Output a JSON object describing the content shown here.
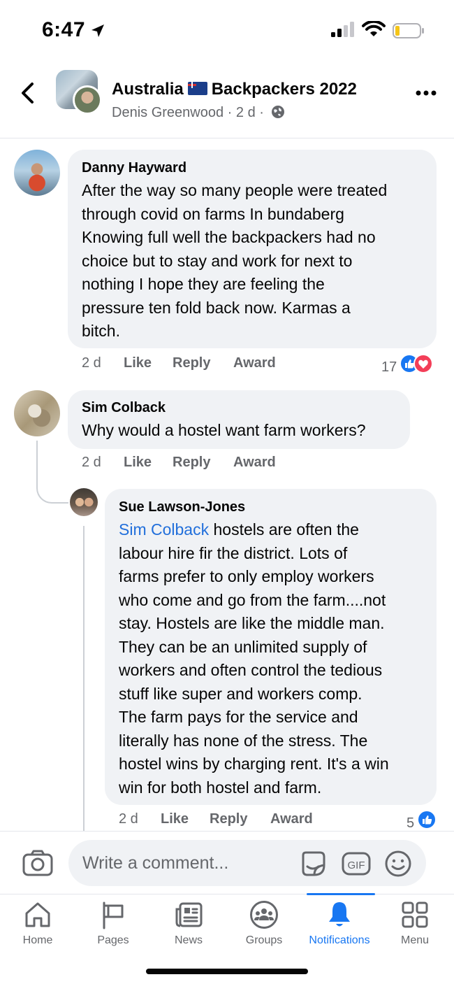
{
  "status_bar": {
    "time": "6:47"
  },
  "group_header": {
    "title_before_flag": "Australia",
    "title_after_flag": "Backpackers 2022",
    "author": "Denis Greenwood",
    "age": "2 d",
    "separator": "·"
  },
  "comments": [
    {
      "name": "Danny Hayward",
      "lines": [
        "After the way so many people were treated",
        "through covid on farms In bundaberg",
        "Knowing full well the backpackers had no",
        "choice but to stay and work for next to",
        "nothing I hope they are feeling the",
        "pressure ten fold back now. Karmas a",
        "bitch."
      ],
      "time": "2 d",
      "like": "Like",
      "reply": "Reply",
      "award": "Award",
      "reaction_count": "17"
    },
    {
      "name": "Sim Colback",
      "lines": [
        "Why would a hostel want farm workers?"
      ],
      "time": "2 d",
      "like": "Like",
      "reply": "Reply",
      "award": "Award"
    },
    {
      "name": "Sue Lawson-Jones",
      "mention": "Sim Colback",
      "first_line_rest": " hostels are often the",
      "lines": [
        "labour hire fir the district. Lots of",
        "farms prefer to only employ workers",
        "who come and go from the farm....not",
        "stay. Hostels are like the middle man.",
        "They can be an unlimited supply of",
        "workers and often control the tedious",
        "stuff like super and workers comp.",
        "The farm pays for the service and",
        "literally has none of the stress. The",
        "hostel wins by charging rent. It's a win",
        "win for both hostel and farm."
      ],
      "time": "2 d",
      "like": "Like",
      "reply": "Reply",
      "award": "Award",
      "reaction_count": "5"
    }
  ],
  "composer": {
    "placeholder": "Write a comment...",
    "gif": "GIF"
  },
  "nav": {
    "items": [
      {
        "label": "Home",
        "icon": "home-icon"
      },
      {
        "label": "Pages",
        "icon": "flag-icon"
      },
      {
        "label": "News",
        "icon": "newspaper-icon"
      },
      {
        "label": "Groups",
        "icon": "groups-icon"
      },
      {
        "label": "Notifications",
        "icon": "bell-icon"
      },
      {
        "label": "Menu",
        "icon": "grid-icon"
      }
    ],
    "active": "Notifications"
  },
  "colors": {
    "accent": "#1877f2",
    "mention": "#216fdb",
    "bubble": "#f0f2f5",
    "secondary_text": "#65676b",
    "love": "#f33e58"
  }
}
